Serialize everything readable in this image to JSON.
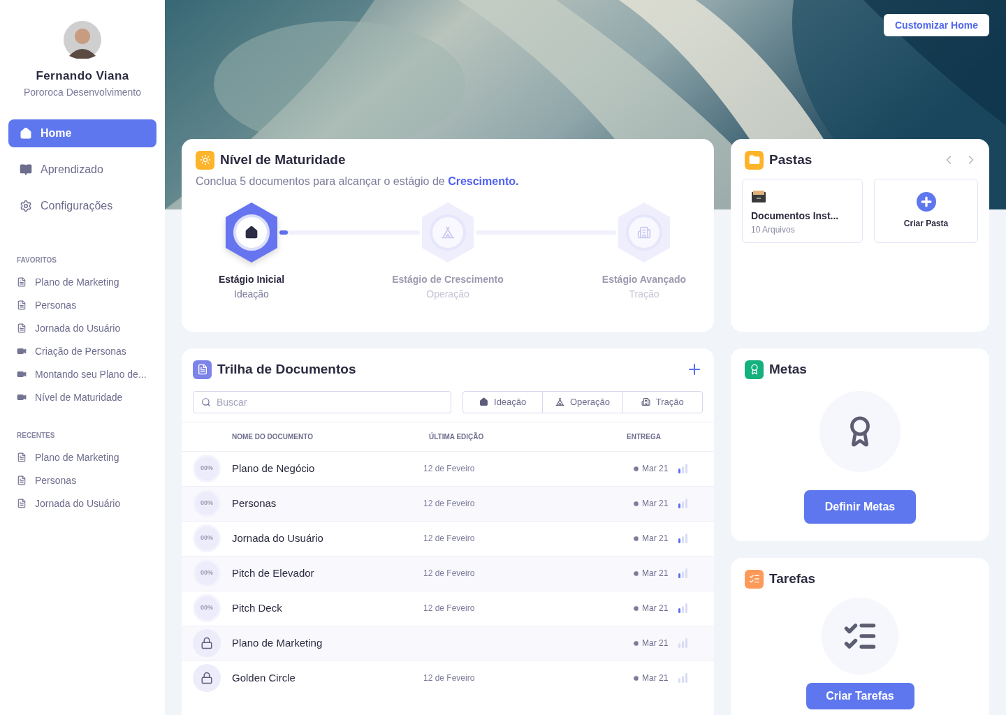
{
  "profile": {
    "name": "Fernando Viana",
    "company": "Pororoca Desenvolvimento"
  },
  "nav": [
    {
      "label": "Home",
      "selected": true
    },
    {
      "label": "Aprendizado",
      "selected": false
    },
    {
      "label": "Configurações",
      "selected": false
    }
  ],
  "sections": [
    {
      "title": "FAVORITOS",
      "items": [
        {
          "label": "Plano de Marketing",
          "kind": "doc"
        },
        {
          "label": "Personas",
          "kind": "doc"
        },
        {
          "label": "Jornada do Usuário",
          "kind": "doc"
        },
        {
          "label": "Criação de Personas",
          "kind": "video"
        },
        {
          "label": "Montando seu Plano de...",
          "kind": "video"
        },
        {
          "label": "Nível de Maturidade",
          "kind": "video"
        }
      ]
    },
    {
      "title": "RECENTES",
      "items": [
        {
          "label": "Plano de Marketing",
          "kind": "doc"
        },
        {
          "label": "Personas",
          "kind": "doc"
        },
        {
          "label": "Jornada do Usuário",
          "kind": "doc"
        }
      ]
    }
  ],
  "customize_button": "Customizar Home",
  "maturity": {
    "title": "Nível de Maturidade",
    "subtitle": "Conclua 5 documentos para alcançar o estágio de **Crescimento.**",
    "level": 0.03,
    "stages": [
      {
        "title": "Estágio Inicial",
        "subtitle": "Ideação",
        "selected": true
      },
      {
        "title": "Estágio de Crescimento",
        "subtitle": "Operação",
        "selected": false
      },
      {
        "title": "Estágio Avançado",
        "subtitle": "Tração",
        "selected": false
      }
    ]
  },
  "folders": {
    "title": "Pastas",
    "items": [
      {
        "kind": "folder",
        "name": "Documentos Inst...",
        "count": "10 Arquivos"
      },
      {
        "kind": "create",
        "name": "Criar Pasta"
      }
    ]
  },
  "documents": {
    "title": "Trilha de Documentos",
    "search_placeholder": "Buscar",
    "filters": [
      {
        "label": "Ideação"
      },
      {
        "label": "Operação"
      },
      {
        "label": "Tração"
      }
    ],
    "columns": [
      "NOME DO DOCUMENTO",
      "ÚLTIMA EDIÇÃO",
      "ENTREGA"
    ],
    "rows": [
      {
        "kind": "progress",
        "progress": "00%",
        "name": "Plano de Negócio",
        "edited": "12 de Feveiro",
        "due": "Mar 21"
      },
      {
        "kind": "progress",
        "progress": "00%",
        "name": "Personas",
        "edited": "12 de Feveiro",
        "due": "Mar 21"
      },
      {
        "kind": "progress",
        "progress": "00%",
        "name": "Jornada do Usuário",
        "edited": "12 de Feveiro",
        "due": "Mar 21"
      },
      {
        "kind": "progress",
        "progress": "00%",
        "name": "Pitch de Elevador",
        "edited": "12 de Feveiro",
        "due": "Mar 21"
      },
      {
        "kind": "progress",
        "progress": "00%",
        "name": "Pitch Deck",
        "edited": "12 de Feveiro",
        "due": "Mar 21"
      },
      {
        "kind": "locked",
        "name": "Plano de Marketing",
        "due": "Mar 21"
      },
      {
        "kind": "locked",
        "name": "Golden Circle",
        "edited": "12 de Feveiro",
        "due": "Mar 21"
      }
    ]
  },
  "goals": {
    "title": "Metas",
    "button": "Definir Metas"
  },
  "tasks": {
    "title": "Tarefas",
    "button": "Criar Tarefas"
  }
}
